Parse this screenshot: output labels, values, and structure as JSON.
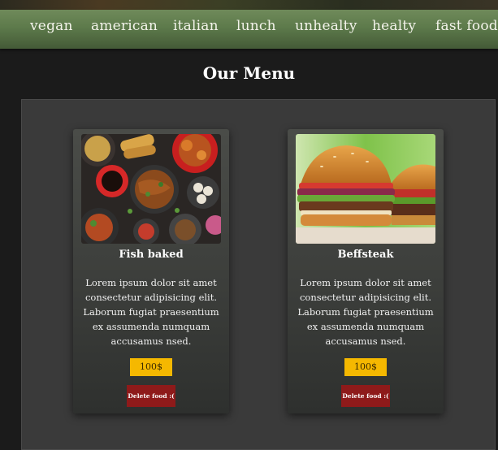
{
  "nav": {
    "items": [
      {
        "label": "vegan"
      },
      {
        "label": "american"
      },
      {
        "label": "italian"
      },
      {
        "label": "lunch"
      },
      {
        "label": "unhealty"
      },
      {
        "label": "healty"
      },
      {
        "label": "fast food"
      }
    ]
  },
  "menu": {
    "title": "Our Menu",
    "cards": [
      {
        "name": "Fish baked",
        "description": "Lorem ipsum dolor sit amet consectetur adipisicing elit. Laborum fugiat praesentium ex assumenda numquam accusamus nsed.",
        "price": "100$",
        "delete_label": "Delete food :(",
        "image_icon": "asian-dishes-photo"
      },
      {
        "name": "Beffsteak",
        "description": "Lorem ipsum dolor sit amet consectetur adipisicing elit. Laborum fugiat praesentium ex assumenda numquam accusamus nsed.",
        "price": "100$",
        "delete_label": "Delete food :(",
        "image_icon": "burger-photo"
      }
    ]
  },
  "colors": {
    "nav": "#5d7a4b",
    "price_badge": "#f5b800",
    "delete_button": "#8e1a1a",
    "background": "#1b1b1b"
  }
}
